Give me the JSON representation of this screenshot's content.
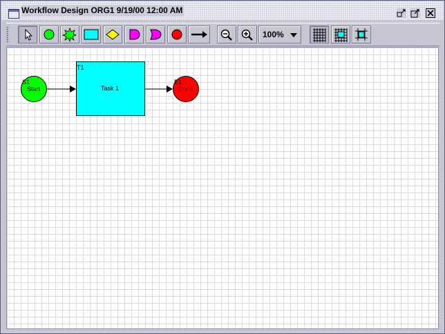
{
  "window": {
    "title": "Workflow Design ORG1 9/19/00 12:00 AM",
    "buttons": [
      "minimize-icon",
      "maximize-icon",
      "close-icon"
    ]
  },
  "toolbar": {
    "tools": [
      {
        "name": "select-tool",
        "icon": "arrow-pointer-icon",
        "pressed": true
      },
      {
        "name": "start-node-tool",
        "icon": "green-circle-icon",
        "color": "#00ff00"
      },
      {
        "name": "event-node-tool",
        "icon": "green-star-icon",
        "color": "#00ff00"
      },
      {
        "name": "task-node-tool",
        "icon": "cyan-rectangle-icon",
        "color": "#00ffff"
      },
      {
        "name": "decision-node-tool",
        "icon": "yellow-diamond-icon",
        "color": "#ffff00"
      },
      {
        "name": "and-node-tool",
        "icon": "magenta-and-gate-icon",
        "color": "#ff00ff"
      },
      {
        "name": "or-node-tool",
        "icon": "magenta-or-gate-icon",
        "color": "#ff00ff"
      },
      {
        "name": "end-node-tool",
        "icon": "red-circle-icon",
        "color": "#ff0000"
      },
      {
        "name": "connector-tool",
        "icon": "arrow-right-icon"
      },
      {
        "name": "zoom-out-button",
        "icon": "zoom-out-icon"
      },
      {
        "name": "zoom-in-button",
        "icon": "zoom-in-icon"
      },
      {
        "name": "show-grid-button",
        "icon": "grid-icon",
        "pressed": true
      },
      {
        "name": "snap-to-grid-button",
        "icon": "snap-grid-icon"
      },
      {
        "name": "align-grid-button",
        "icon": "align-grid-icon"
      }
    ],
    "zoom_level": "100%"
  },
  "diagram": {
    "nodes": [
      {
        "id": "S1",
        "label": "Start",
        "shape": "circle",
        "color": "#00ff00"
      },
      {
        "id": "T1",
        "label": "Task 1",
        "shape": "rectangle",
        "color": "#00ffff"
      },
      {
        "id": "E1",
        "label": "Done",
        "shape": "circle",
        "color": "#ff0000"
      }
    ],
    "edges": [
      {
        "from": "S1",
        "to": "T1"
      },
      {
        "from": "T1",
        "to": "E1"
      }
    ]
  }
}
